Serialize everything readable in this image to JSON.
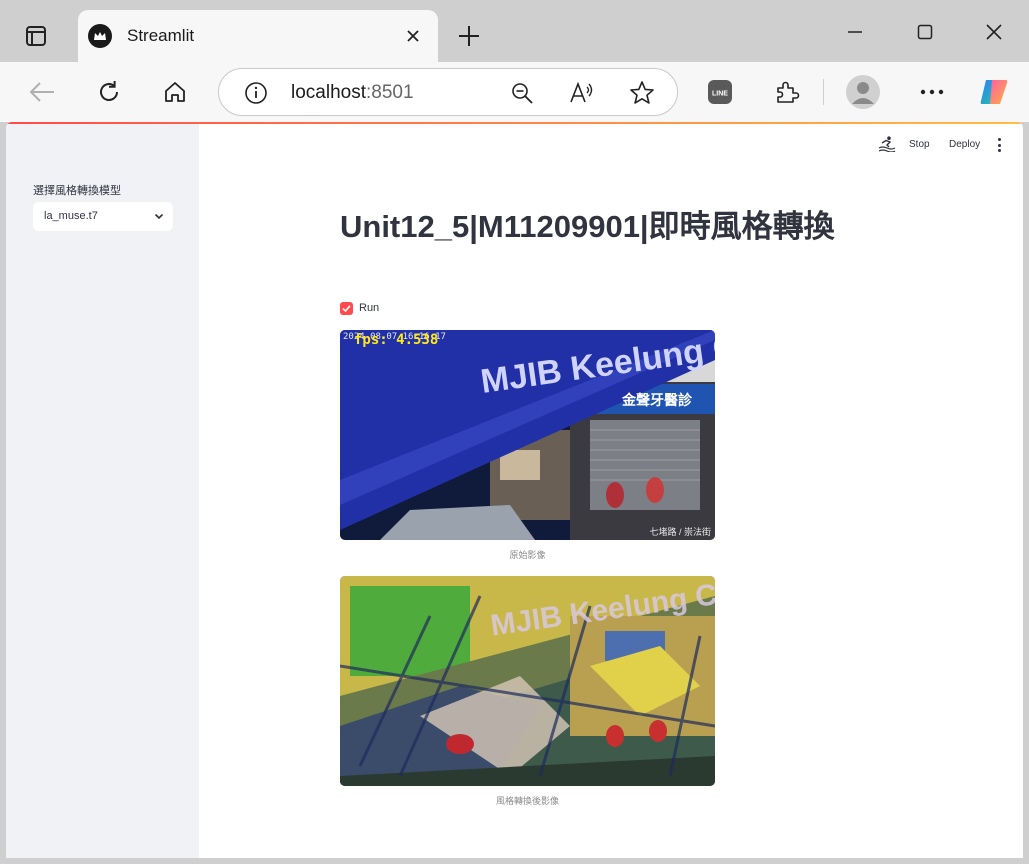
{
  "browser": {
    "tab_title": "Streamlit",
    "url_host": "localhost",
    "url_port": ":8501"
  },
  "sidebar": {
    "select_label": "選擇風格轉換模型",
    "select_value": "la_muse.t7"
  },
  "header": {
    "stop_label": "Stop",
    "deploy_label": "Deploy"
  },
  "main": {
    "title": "Unit12_5|M11209901|即時風格轉換",
    "run_checkbox": {
      "label": "Run",
      "checked": true
    },
    "original": {
      "caption": "原始影像",
      "overlay_fps": "fps: 4.538",
      "overlay_timestamp": "2024-08-07 16:16:17",
      "overlay_street": "七堵路 / 崇法街",
      "sign_text": "MJIB Keelung City",
      "dental_sign": "金聲牙醫診"
    },
    "styled": {
      "caption": "風格轉換後影像"
    }
  },
  "colors": {
    "accent": "#ff4b4b",
    "sidebar_bg": "#f0f2f6",
    "text": "#31333f"
  }
}
